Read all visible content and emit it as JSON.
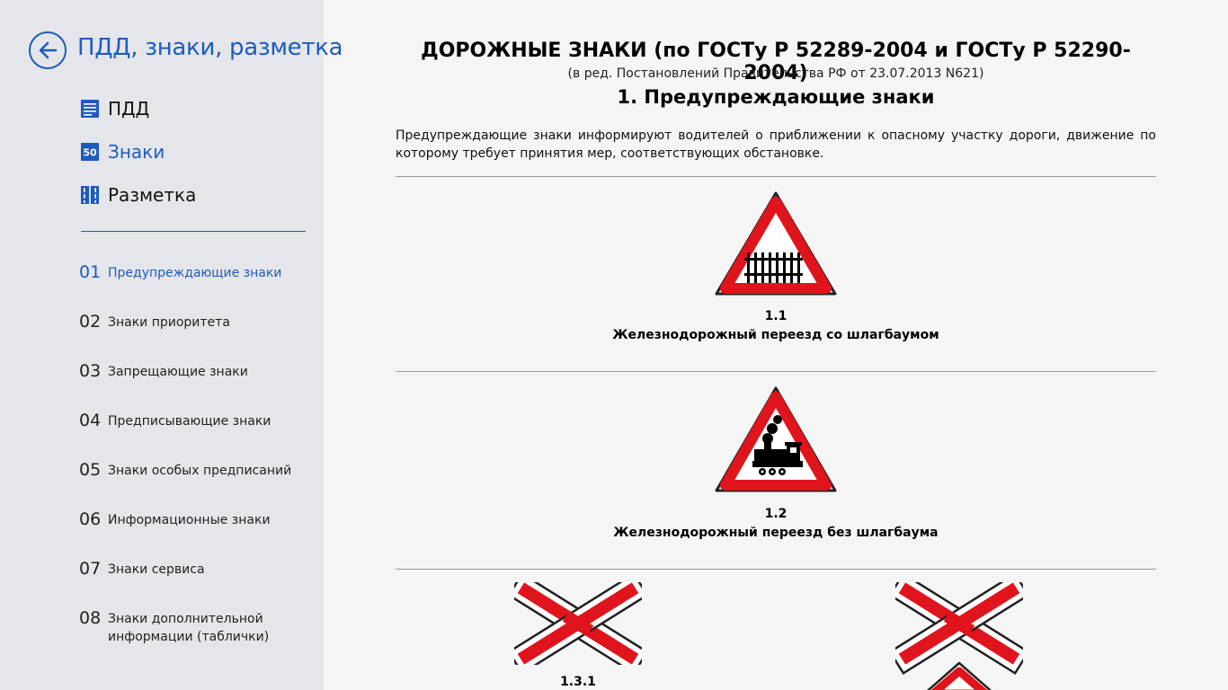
{
  "sidebar": {
    "app_title": "ПДД, знаки, разметка",
    "nav": [
      {
        "label": "ПДД",
        "icon": "document-icon"
      },
      {
        "label": "Знаки",
        "icon": "sign-50-icon",
        "icon_text": "50"
      },
      {
        "label": "Разметка",
        "icon": "road-marking-icon"
      }
    ],
    "categories": [
      {
        "num": "01",
        "label": "Предупреждающие знаки"
      },
      {
        "num": "02",
        "label": "Знаки приоритета"
      },
      {
        "num": "03",
        "label": "Запрещающие знаки"
      },
      {
        "num": "04",
        "label": "Предписывающие знаки"
      },
      {
        "num": "05",
        "label": "Знаки особых предписаний"
      },
      {
        "num": "06",
        "label": "Информационные знаки"
      },
      {
        "num": "07",
        "label": "Знаки сервиса"
      },
      {
        "num": "08",
        "label": "Знаки дополнительной информации (таблички)"
      }
    ]
  },
  "content": {
    "title": "ДОРОЖНЫЕ ЗНАКИ (по ГОСТу Р 52289-2004 и ГОСТу Р 52290-2004)",
    "subtitle": "(в ред. Постановлений Правительства РФ от 23.07.2013 N621)",
    "section_title": "1. Предупреждающие знаки",
    "intro": "Предупреждающие знаки информируют водителей о приближении к опасному участку дороги, движение по которому требует принятия мер, соответствующих обстановке.",
    "signs": [
      {
        "code": "1.1",
        "name": "Железнодорожный переезд со шлагбаумом",
        "icon": "railway-barrier-sign"
      },
      {
        "code": "1.2",
        "name": "Железнодорожный переезд без шлагбаума",
        "icon": "steam-locomotive-sign"
      },
      {
        "code": "1.3.1",
        "name": "",
        "icon": "single-track-cross-sign"
      },
      {
        "code": "",
        "name": "",
        "icon": "multi-track-cross-sign"
      }
    ]
  },
  "colors": {
    "accent": "#1f5bbf",
    "sign_red": "#e0141c",
    "sidebar_bg": "#e4e6ea",
    "main_bg": "#f5f5f5"
  }
}
